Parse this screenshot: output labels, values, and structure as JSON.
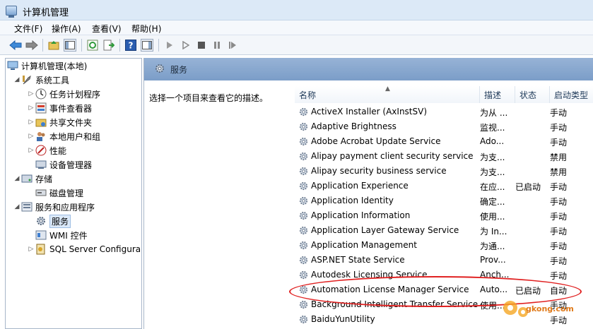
{
  "window": {
    "title": "计算机管理"
  },
  "menu": [
    "文件(F)",
    "操作(A)",
    "查看(V)",
    "帮助(H)"
  ],
  "tree": [
    {
      "label": "计算机管理(本地)",
      "icon": "computer-management-icon"
    },
    {
      "label": "系统工具",
      "icon": "system-tools-icon"
    },
    {
      "label": "任务计划程序",
      "icon": "clock-icon"
    },
    {
      "label": "事件查看器",
      "icon": "event-viewer-icon"
    },
    {
      "label": "共享文件夹",
      "icon": "shared-folder-icon"
    },
    {
      "label": "本地用户和组",
      "icon": "users-icon"
    },
    {
      "label": "性能",
      "icon": "performance-icon"
    },
    {
      "label": "设备管理器",
      "icon": "device-manager-icon"
    },
    {
      "label": "存储",
      "icon": "storage-icon"
    },
    {
      "label": "磁盘管理",
      "icon": "disk-icon"
    },
    {
      "label": "服务和应用程序",
      "icon": "services-apps-icon"
    },
    {
      "label": "服务",
      "icon": "gear-icon"
    },
    {
      "label": "WMI 控件",
      "icon": "wmi-icon"
    },
    {
      "label": "SQL Server Configura",
      "icon": "sql-server-icon"
    }
  ],
  "panel": {
    "title": "服务",
    "description": "选择一个项目来查看它的描述。"
  },
  "columns": {
    "name": "名称",
    "desc": "描述",
    "status": "状态",
    "startup": "启动类型"
  },
  "services": [
    {
      "name": "ActiveX Installer (AxInstSV)",
      "desc": "为从 ...",
      "status": "",
      "startup": "手动"
    },
    {
      "name": "Adaptive Brightness",
      "desc": "监视...",
      "status": "",
      "startup": "手动"
    },
    {
      "name": "Adobe Acrobat Update Service",
      "desc": "Ado...",
      "status": "",
      "startup": "手动"
    },
    {
      "name": "Alipay payment client security service",
      "desc": "为支...",
      "status": "",
      "startup": "禁用"
    },
    {
      "name": "Alipay security business service",
      "desc": "为支...",
      "status": "",
      "startup": "禁用"
    },
    {
      "name": "Application Experience",
      "desc": "在应...",
      "status": "已启动",
      "startup": "手动"
    },
    {
      "name": "Application Identity",
      "desc": "确定...",
      "status": "",
      "startup": "手动"
    },
    {
      "name": "Application Information",
      "desc": "使用...",
      "status": "",
      "startup": "手动"
    },
    {
      "name": "Application Layer Gateway Service",
      "desc": "为 In...",
      "status": "",
      "startup": "手动"
    },
    {
      "name": "Application Management",
      "desc": "为通...",
      "status": "",
      "startup": "手动"
    },
    {
      "name": "ASP.NET State Service",
      "desc": "Prov...",
      "status": "",
      "startup": "手动"
    },
    {
      "name": "Autodesk Licensing Service",
      "desc": "Anch...",
      "status": "",
      "startup": "手动"
    },
    {
      "name": "Automation License Manager Service",
      "desc": "Auto...",
      "status": "已启动",
      "startup": "自动"
    },
    {
      "name": "Background Intelligent Transfer Service",
      "desc": "使用...",
      "status": "",
      "startup": "手动"
    },
    {
      "name": "BaiduYunUtility",
      "desc": "",
      "status": "",
      "startup": "手动"
    }
  ],
  "watermark": {
    "text": "gkong.com"
  }
}
